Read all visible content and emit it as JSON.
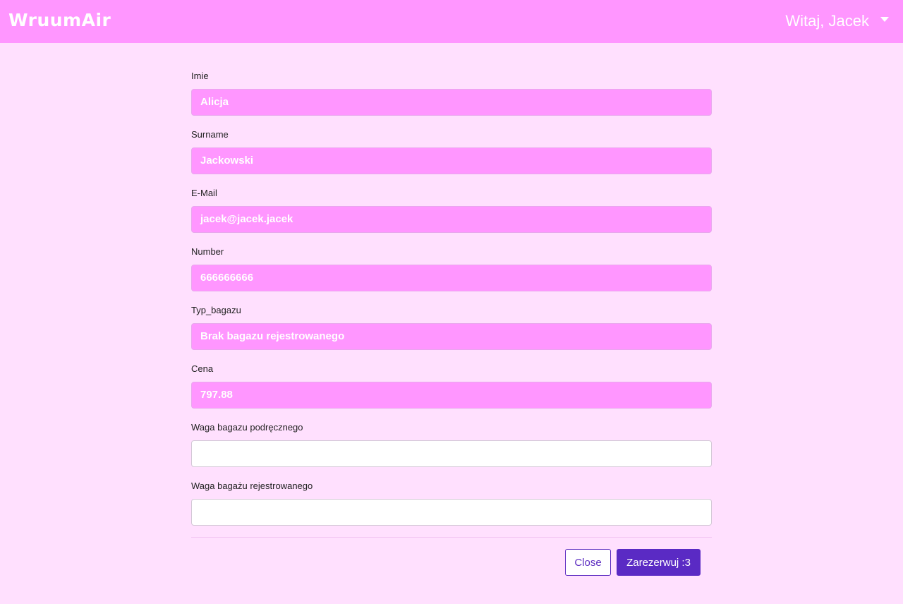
{
  "header": {
    "brand": "WruumAir",
    "greeting": "Witaj, Jacek"
  },
  "form": {
    "fields": [
      {
        "label": "Imie",
        "value": "Alicja"
      },
      {
        "label": "Surname",
        "value": "Jackowski"
      },
      {
        "label": "E-Mail",
        "value": "jacek@jacek.jacek"
      },
      {
        "label": "Number",
        "value": "666666666"
      },
      {
        "label": "Typ_bagazu",
        "value": "Brak bagazu rejestrowanego"
      },
      {
        "label": "Cena",
        "value": "797.88"
      },
      {
        "label": "Waga bagazu podręcznego",
        "value": ""
      },
      {
        "label": "Waga bagażu rejestrowanego",
        "value": ""
      }
    ]
  },
  "actions": {
    "close_label": "Close",
    "book_label": "Zarezerwuj :3"
  },
  "colors": {
    "header_bg": "#ff96ff",
    "page_bg": "#ffe0fe",
    "filled_input_bg": "#ff96ff",
    "primary": "#5a2ac4"
  }
}
